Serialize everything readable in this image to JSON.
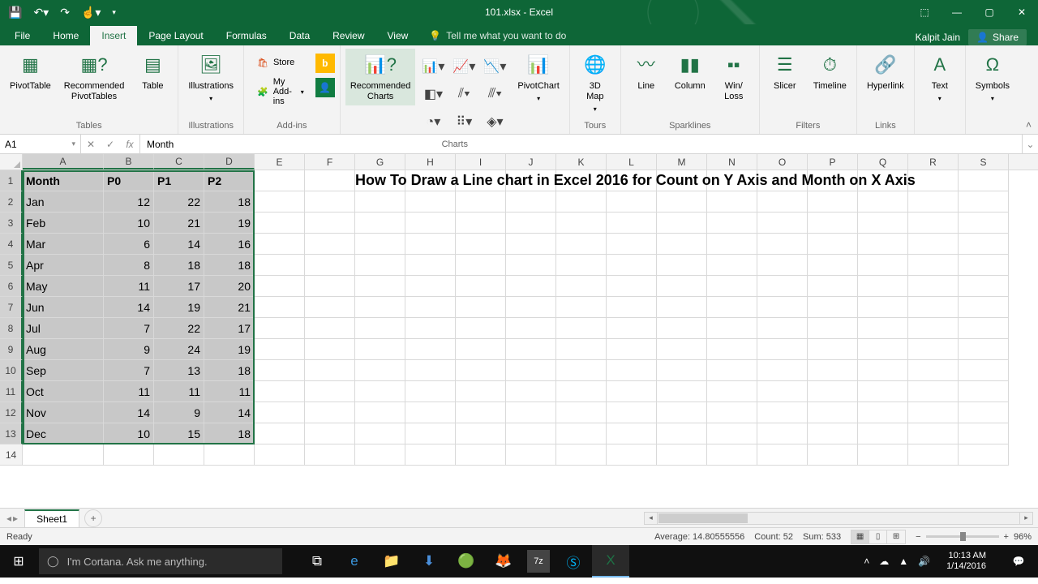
{
  "title": "101.xlsx - Excel",
  "account": "Kalpit Jain",
  "share": "Share",
  "tabs": [
    "File",
    "Home",
    "Insert",
    "Page Layout",
    "Formulas",
    "Data",
    "Review",
    "View"
  ],
  "active_tab": "Insert",
  "tellme": "Tell me what you want to do",
  "ribbon": {
    "tables": {
      "pivot": "PivotTable",
      "recpivot": "Recommended\nPivotTables",
      "table": "Table",
      "label": "Tables"
    },
    "illus": {
      "btn": "Illustrations",
      "label": "Illustrations"
    },
    "addins": {
      "store": "Store",
      "my": "My Add-ins",
      "label": "Add-ins"
    },
    "charts": {
      "rec": "Recommended\nCharts",
      "pivotchart": "PivotChart",
      "label": "Charts"
    },
    "tours": {
      "map": "3D\nMap",
      "label": "Tours"
    },
    "spark": {
      "line": "Line",
      "col": "Column",
      "wl": "Win/\nLoss",
      "label": "Sparklines"
    },
    "filters": {
      "slicer": "Slicer",
      "timeline": "Timeline",
      "label": "Filters"
    },
    "links": {
      "hyp": "Hyperlink",
      "label": "Links"
    },
    "text": {
      "text": "Text",
      "label": ""
    },
    "symbols": {
      "sym": "Symbols",
      "label": ""
    }
  },
  "namebox": "A1",
  "formula": "Month",
  "columns": [
    "A",
    "B",
    "C",
    "D",
    "E",
    "F",
    "G",
    "H",
    "I",
    "J",
    "K",
    "L",
    "M",
    "N",
    "O",
    "P",
    "Q",
    "R",
    "S"
  ],
  "selected_cols": 4,
  "rownums": [
    1,
    2,
    3,
    4,
    5,
    6,
    7,
    8,
    9,
    10,
    11,
    12,
    13,
    14
  ],
  "selected_rows": 13,
  "headers": [
    "Month",
    "P0",
    "P1",
    "P2"
  ],
  "rows": [
    [
      "Jan",
      12,
      22,
      18
    ],
    [
      "Feb",
      10,
      21,
      19
    ],
    [
      "Mar",
      6,
      14,
      16
    ],
    [
      "Apr",
      8,
      18,
      18
    ],
    [
      "May",
      11,
      17,
      20
    ],
    [
      "Jun",
      14,
      19,
      21
    ],
    [
      "Jul",
      7,
      22,
      17
    ],
    [
      "Aug",
      9,
      24,
      19
    ],
    [
      "Sep",
      7,
      13,
      18
    ],
    [
      "Oct",
      11,
      11,
      11
    ],
    [
      "Nov",
      14,
      9,
      14
    ],
    [
      "Dec",
      10,
      15,
      18
    ]
  ],
  "overlay_text": "How To Draw a Line chart in Excel 2016 for  Count on Y Axis and Month on X Axis",
  "sheet": "Sheet1",
  "status": {
    "ready": "Ready",
    "avg": "Average: 14.80555556",
    "count": "Count: 52",
    "sum": "Sum: 533",
    "zoom": "96%"
  },
  "cortana": "I'm Cortana. Ask me anything.",
  "clock": {
    "time": "10:13 AM",
    "date": "1/14/2016"
  }
}
